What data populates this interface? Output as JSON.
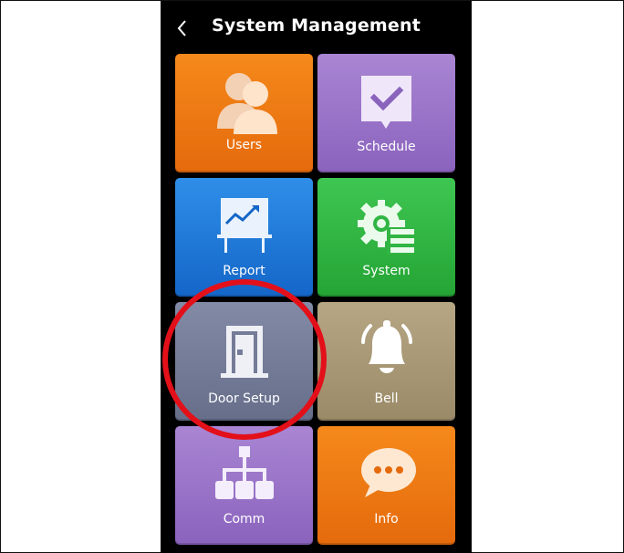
{
  "header": {
    "title": "System Management",
    "back_icon": "chevron-left-icon"
  },
  "menu": {
    "users": {
      "label": "Users",
      "icon": "users-icon",
      "color": "#f07e16"
    },
    "schedule": {
      "label": "Schedule",
      "icon": "calendar-check-icon",
      "color": "#9a74c8"
    },
    "report": {
      "label": "Report",
      "icon": "chart-monitor-icon",
      "color": "#237ad9"
    },
    "system": {
      "label": "System",
      "icon": "gear-list-icon",
      "color": "#31b543"
    },
    "door": {
      "label": "Door Setup",
      "icon": "door-icon",
      "color": "#747c98"
    },
    "bell": {
      "label": "Bell",
      "icon": "bell-icon",
      "color": "#a89876"
    },
    "comm": {
      "label": "Comm",
      "icon": "network-icon",
      "color": "#9a74c8"
    },
    "info": {
      "label": "Info",
      "icon": "chat-bubble-icon",
      "color": "#f07e16"
    }
  },
  "annotation": {
    "highlight_color": "#e3101a"
  }
}
